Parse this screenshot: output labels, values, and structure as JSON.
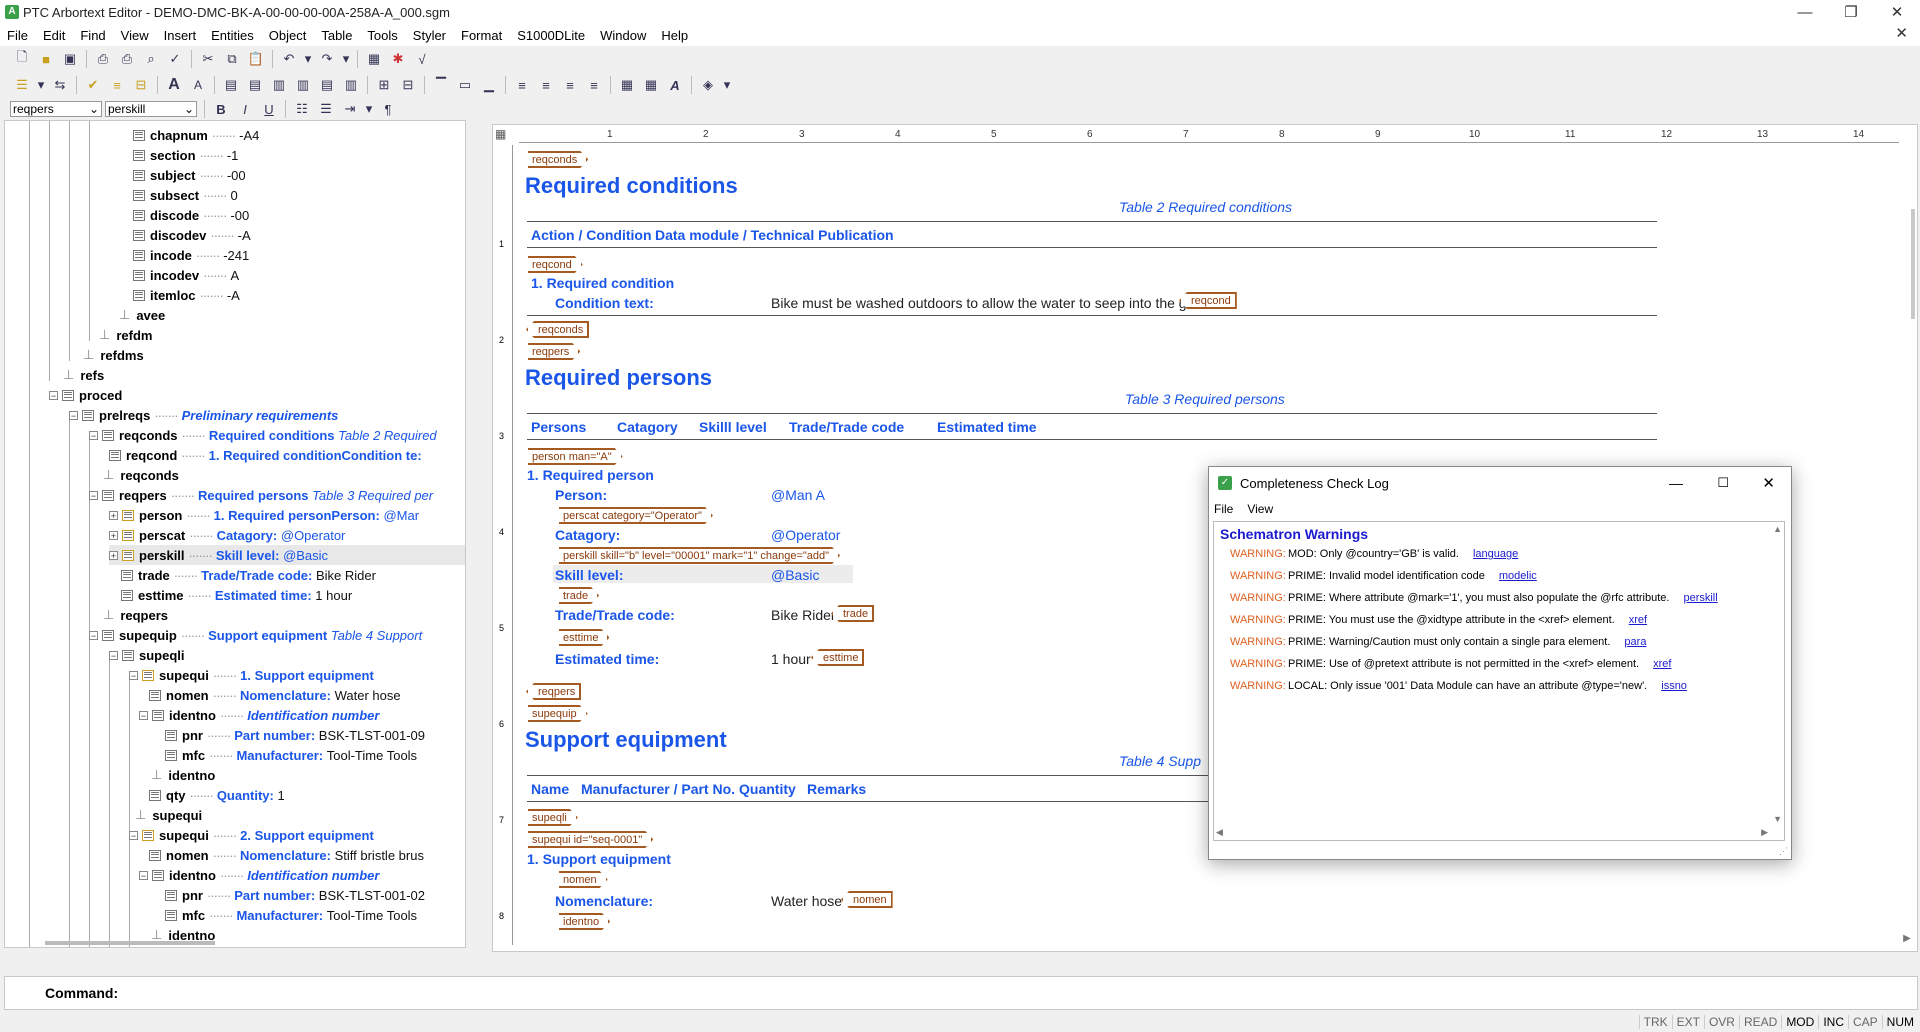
{
  "window": {
    "title": "PTC Arbortext Editor - DEMO-DMC-BK-A-00-00-00-00A-258A-A_000.sgm",
    "min": "—",
    "max": "❐",
    "close": "✕"
  },
  "menu": [
    "File",
    "Edit",
    "Find",
    "View",
    "Insert",
    "Entities",
    "Object",
    "Table",
    "Tools",
    "Styler",
    "Format",
    "S1000DLite",
    "Window",
    "Help"
  ],
  "toolbar": {
    "element_combo": "reqpers",
    "tag_combo": "perskill",
    "bold": "B",
    "italic": "I",
    "underline": "U",
    "pilcrow": "¶"
  },
  "tree": {
    "r0": {
      "name": "chapnum",
      "val": "-A4"
    },
    "r1": {
      "name": "section",
      "val": "-1"
    },
    "r2": {
      "name": "subject",
      "val": "-00"
    },
    "r3": {
      "name": "subsect",
      "val": "0"
    },
    "r4": {
      "name": "discode",
      "val": "-00"
    },
    "r5": {
      "name": "discodev",
      "val": "-A"
    },
    "r6": {
      "name": "incode",
      "val": "-241"
    },
    "r7": {
      "name": "incodev",
      "val": "A"
    },
    "r8": {
      "name": "itemloc",
      "val": "-A"
    },
    "r9": {
      "name": "avee"
    },
    "r10": {
      "name": "refdm"
    },
    "r11": {
      "name": "refdms"
    },
    "r12": {
      "name": "refs"
    },
    "r13": {
      "name": "proced"
    },
    "r14": {
      "name": "prelreqs",
      "val": "Preliminary requirements"
    },
    "r15": {
      "name": "reqconds",
      "val": "Required conditions",
      "extra": "Table 2 Required"
    },
    "r16": {
      "name": "reqcond",
      "val": "1. Required conditionCondition te:"
    },
    "r17": {
      "name": "reqconds"
    },
    "r18": {
      "name": "reqpers",
      "val": "Required persons",
      "extra": "Table 3 Required per"
    },
    "r19": {
      "name": "person",
      "val": "1. Required personPerson:",
      "extra": "@Mar"
    },
    "r20": {
      "name": "perscat",
      "val": "Catagory:",
      "extra": "@Operator"
    },
    "r21": {
      "name": "perskill",
      "val": "Skill level:",
      "extra": "@Basic"
    },
    "r22": {
      "name": "trade",
      "val": "Trade/Trade code:",
      "extra": "Bike Rider"
    },
    "r23": {
      "name": "esttime",
      "val": "Estimated time:",
      "extra": "1 hour"
    },
    "r24": {
      "name": "reqpers"
    },
    "r25": {
      "name": "supequip",
      "val": "Support equipment",
      "extra": "Table 4 Support"
    },
    "r26": {
      "name": "supeqli"
    },
    "r27": {
      "name": "supequi",
      "val": "1. Support equipment"
    },
    "r28": {
      "name": "nomen",
      "val": "Nomenclature:",
      "extra": "Water hose"
    },
    "r29": {
      "name": "identno",
      "val": "Identification number"
    },
    "r30": {
      "name": "pnr",
      "val": "Part number:",
      "extra": "BSK-TLST-001-09"
    },
    "r31": {
      "name": "mfc",
      "val": "Manufacturer:",
      "extra": "Tool-Time Tools"
    },
    "r32": {
      "name": "identno"
    },
    "r33": {
      "name": "qty",
      "val": "Quantity:",
      "extra": "1"
    },
    "r34": {
      "name": "supequi"
    },
    "r35": {
      "name": "supequi",
      "val": "2. Support equipment"
    },
    "r36": {
      "name": "nomen",
      "val": "Nomenclature:",
      "extra": "Stiff bristle brus"
    },
    "r37": {
      "name": "identno",
      "val": "Identification number"
    },
    "r38": {
      "name": "pnr",
      "val": "Part number:",
      "extra": "BSK-TLST-001-02"
    },
    "r39": {
      "name": "mfc",
      "val": "Manufacturer:",
      "extra": "Tool-Time Tools"
    },
    "r40": {
      "name": "identno"
    }
  },
  "ruler": [
    "1",
    "2",
    "3",
    "4",
    "5",
    "6",
    "7",
    "8",
    "9",
    "10",
    "11",
    "12",
    "13",
    "14"
  ],
  "vruler": [
    "1",
    "2",
    "3",
    "4",
    "5",
    "6",
    "7",
    "8"
  ],
  "doc": {
    "t_reqconds": "reqconds",
    "h_reqconds": "Required conditions",
    "cap2": "Table 2  Required conditions",
    "th_action": "Action / Condition",
    "th_dm": "Data module / Technical Publication",
    "t_reqcond": "reqcond",
    "rc_title": "1. Required condition",
    "rc_label": "Condition text:",
    "rc_text": "Bike must be washed outdoors to allow the water to seep into the ground",
    "t_reqcond_end": "reqcond",
    "t_reqconds_end": "reqconds",
    "t_reqpers": "reqpers",
    "h_reqpers": "Required persons",
    "cap3": "Table 3  Required persons",
    "th_persons": "Persons",
    "th_catagory": "Catagory",
    "th_skill": "Skilll level",
    "th_trade": "Trade/Trade code",
    "th_est": "Estimated time",
    "t_person": "person man=\"A\"",
    "rp_title": "1. Required person",
    "lb_person": "Person:",
    "v_person": "@Man A",
    "t_perscat": "perscat category=\"Operator\"",
    "lb_cat": "Catagory:",
    "v_cat": "@Operator",
    "t_perskill": "perskill skill=\"b\" level=\"00001\" mark=\"1\" change=\"add\"",
    "lb_skill": "Skill level:",
    "v_skill": "@Basic",
    "t_trade": "trade",
    "lb_trade": "Trade/Trade code:",
    "v_trade": "Bike Rider",
    "t_trade_end": "trade",
    "t_esttime": "esttime",
    "lb_est": "Estimated time:",
    "v_est": "1 hour",
    "t_esttime_end": "esttime",
    "t_reqpers_end": "reqpers",
    "t_supequip": "supequip",
    "h_supequip": "Support equipment",
    "cap4": "Table 4  Supp",
    "th_name": "Name",
    "th_mfr": "Manufacturer / Part No.",
    "th_qty": "Quantity",
    "th_rem": "Remarks",
    "t_supeqli": "supeqli",
    "t_supequi": "supequi id=\"seq-0001\"",
    "se_title": "1. Support equipment",
    "t_nomen": "nomen",
    "lb_nomen": "Nomenclature:",
    "v_nomen": "Water hose",
    "t_nomen_end": "nomen",
    "t_identno": "identno"
  },
  "dialog": {
    "title": "Completeness Check Log",
    "menu": [
      "File",
      "View"
    ],
    "heading": "Schematron Warnings",
    "warnings": [
      {
        "level": "WARNING:",
        "msg": "MOD: Only @country='GB' is valid.",
        "link": "language"
      },
      {
        "level": "WARNING:",
        "msg": "PRIME: Invalid model identification code",
        "link": "modelic"
      },
      {
        "level": "WARNING:",
        "msg": "PRIME: Where attribute @mark='1', you must also populate the @rfc attribute.",
        "link": "perskill"
      },
      {
        "level": "WARNING:",
        "msg": "PRIME: You must use the @xidtype attribute in the <xref> element.",
        "link": "xref"
      },
      {
        "level": "WARNING:",
        "msg": "PRIME: Warning/Caution must only contain a single para element.",
        "link": "para"
      },
      {
        "level": "WARNING:",
        "msg": "PRIME: Use of @pretext attribute is not permitted in the <xref> element.",
        "link": "xref"
      },
      {
        "level": "WARNING:",
        "msg": "LOCAL: Only issue '001' Data Module can have an attribute @type='new'.",
        "link": "issno"
      }
    ]
  },
  "command": {
    "label": "Command:"
  },
  "status": [
    "TRK",
    "EXT",
    "OVR",
    "READ",
    "MOD",
    "INC",
    "CAP",
    "NUM"
  ]
}
